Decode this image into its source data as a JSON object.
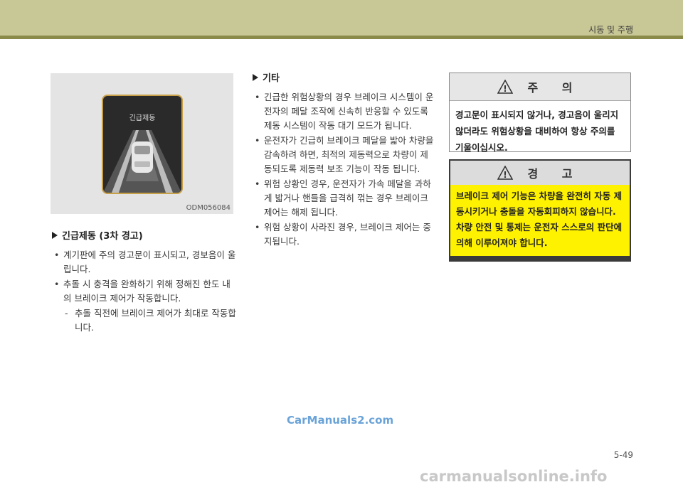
{
  "header": {
    "title": "시동 및 주행"
  },
  "figure": {
    "screen_label": "긴급제동",
    "code": "ODM056084"
  },
  "left": {
    "heading": "긴급제동 (3차 경고)",
    "items": [
      "계기판에 주의 경고문이 표시되고, 경보음이 울립니다.",
      "추돌 시 충격을 완화하기 위해 정해진 한도 내의 브레이크 제어가 작동합니다."
    ],
    "sub_item": "추돌 직전에 브레이크 제어가 최대로 작동합니다."
  },
  "middle": {
    "heading": "기타",
    "items": [
      "긴급한 위험상황의 경우 브레이크 시스템이 운전자의 페달 조작에 신속히 반응할 수 있도록 제동 시스템이 작동 대기 모드가 됩니다.",
      "운전자가 긴급히 브레이크 페달을 밟아 차량을 감속하려 하면, 최적의 제동력으로 차량이 제동되도록 제동력 보조 기능이 작동 됩니다.",
      "위험 상황인 경우, 운전자가 가속 페달을 과하게 밟거나 핸들을 급격히 꺾는 경우 브레이크 제어는 해제 됩니다.",
      "위험 상황이 사라진 경우, 브레이크 제어는 중지됩니다."
    ]
  },
  "caution": {
    "title": "주 의",
    "text": "경고문이 표시되지 않거나, 경고음이 울리지 않더라도 위험상황을 대비하여 항상 주의를 기울이십시오."
  },
  "warning": {
    "title": "경 고",
    "text": "브레이크 제어 기능은 차량을 완전히 자동 제동시키거나 충돌을 자동회피하지 않습니다. 차량 안전 및 통제는 운전자 스스로의 판단에 의해 이루어져야 합니다."
  },
  "page_number": "5-49",
  "watermarks": {
    "site1": "CarManuals2.com",
    "site2": "carmanualsonline.info"
  }
}
